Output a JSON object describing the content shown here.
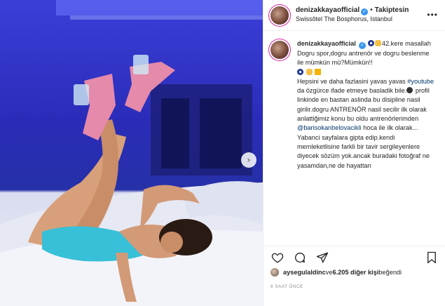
{
  "post": {
    "username": "denizakkayaofficial",
    "follow_dot": "•",
    "follow_label": "Takiptesin",
    "location": "Swissôtel The Bosphorus, Istanbul",
    "more_label": "•••",
    "next_label": "›"
  },
  "caption": {
    "username": "denizakkayaofficial",
    "line1_tail": "42.kere masallah",
    "para1": "Dogru spor,dogru antrenör ve dogru beslenme ile mümkün mü?Mümkün!!",
    "para2_start": "Hepsini ve daha fazlasini yavas yavas ",
    "hashtag": "#youtube",
    "para2_mid": " da özgürce ifade etmeye basladik bile.",
    "para2_end": " profil linkinde en bastan aslinda bu disipline nasil girilir.dogru ANTRENÖR nasil secilir ilk olarak anlattiğimiz konu bu oldu antrenörlerimden",
    "mention": "@barisokanbelovacikli",
    "para2_tail": " hoca ile ilk olarak...",
    "para3": "Yabanci sayfalara gipta edip.kendi memleketlisine farkli bir tavir sergileyenlere diyecek sözüm yok.ancak buradaki fotoğraf ne yasamdan,ne de hayattan"
  },
  "likes": {
    "liker": "aysegulaldinc",
    "middle": " ve ",
    "count": "6.205 diğer kişi",
    "suffix": " beğendi"
  },
  "timestamp": "8 SAAT ÖNCE",
  "icons": [
    "heart-icon",
    "comment-icon",
    "share-icon",
    "bookmark-icon",
    "verified-icon",
    "chevron-right-icon",
    "more-icon"
  ],
  "colors": {
    "accent": "#3897f0",
    "link": "#00376b",
    "photo_blue": "#3b3fd8"
  }
}
